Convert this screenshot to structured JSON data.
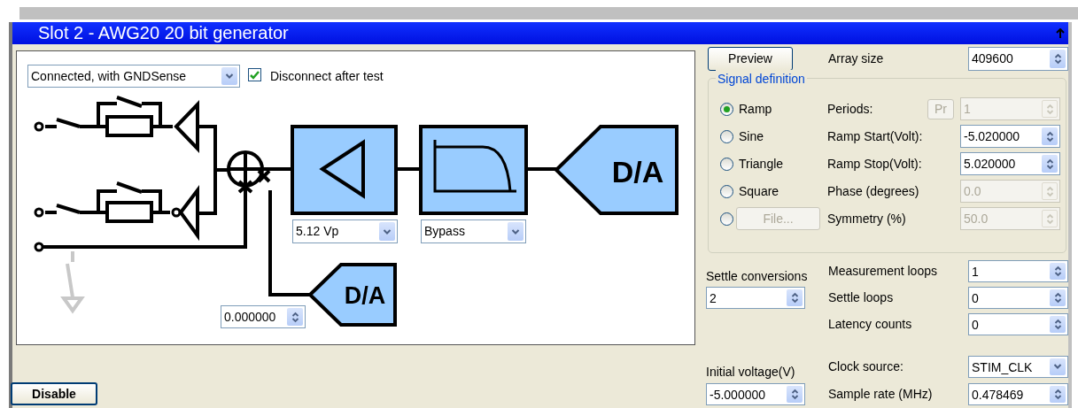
{
  "window": {
    "title": "Slot 2 - AWG20 20 bit generator"
  },
  "diagram": {
    "connection": {
      "value": "Connected, with GNDSense"
    },
    "disconnect_after_test": {
      "label": "Disconnect after test",
      "checked": true
    },
    "range_select": {
      "value": "5.12 Vp"
    },
    "filter_select": {
      "value": "Bypass"
    },
    "offset": {
      "value": "0.000000"
    },
    "converter_labels": [
      "D/A",
      "D/A"
    ]
  },
  "preview_button": "Preview",
  "array_size": {
    "label": "Array size",
    "value": "409600"
  },
  "signal_definition": {
    "title": "Signal definition",
    "waveforms": [
      {
        "kind": "radio",
        "label": "Ramp",
        "selected": true,
        "disabled": false
      },
      {
        "kind": "radio",
        "label": "Sine",
        "selected": false,
        "disabled": false
      },
      {
        "kind": "radio",
        "label": "Triangle",
        "selected": false,
        "disabled": false
      },
      {
        "kind": "radio",
        "label": "Square",
        "selected": false,
        "disabled": false
      },
      {
        "kind": "file",
        "label": "File...",
        "selected": false,
        "disabled": true
      }
    ],
    "parameters": [
      {
        "label": "Periods:",
        "value": "1",
        "disabled": true,
        "button": "Pr"
      },
      {
        "label": "Ramp Start(Volt):",
        "value": "-5.020000",
        "disabled": false
      },
      {
        "label": "Ramp Stop(Volt):",
        "value": "5.020000",
        "disabled": false
      },
      {
        "label": "Phase (degrees)",
        "value": "0.0",
        "disabled": true
      },
      {
        "label": "Symmetry (%)",
        "value": "50.0",
        "disabled": true
      }
    ]
  },
  "settle_conversions": {
    "label": "Settle conversions",
    "value": "2"
  },
  "loops": [
    {
      "label": "Measurement loops",
      "value": "1"
    },
    {
      "label": "Settle loops",
      "value": "0"
    },
    {
      "label": "Latency counts",
      "value": "0"
    }
  ],
  "initial_voltage": {
    "label": "Initial voltage(V)",
    "value": "-5.000000"
  },
  "clock_source": {
    "label": "Clock source:",
    "value": "STIM_CLK"
  },
  "sample_rate": {
    "label": "Sample rate (MHz)",
    "value": "0.478469"
  },
  "disable_button": "Disable"
}
